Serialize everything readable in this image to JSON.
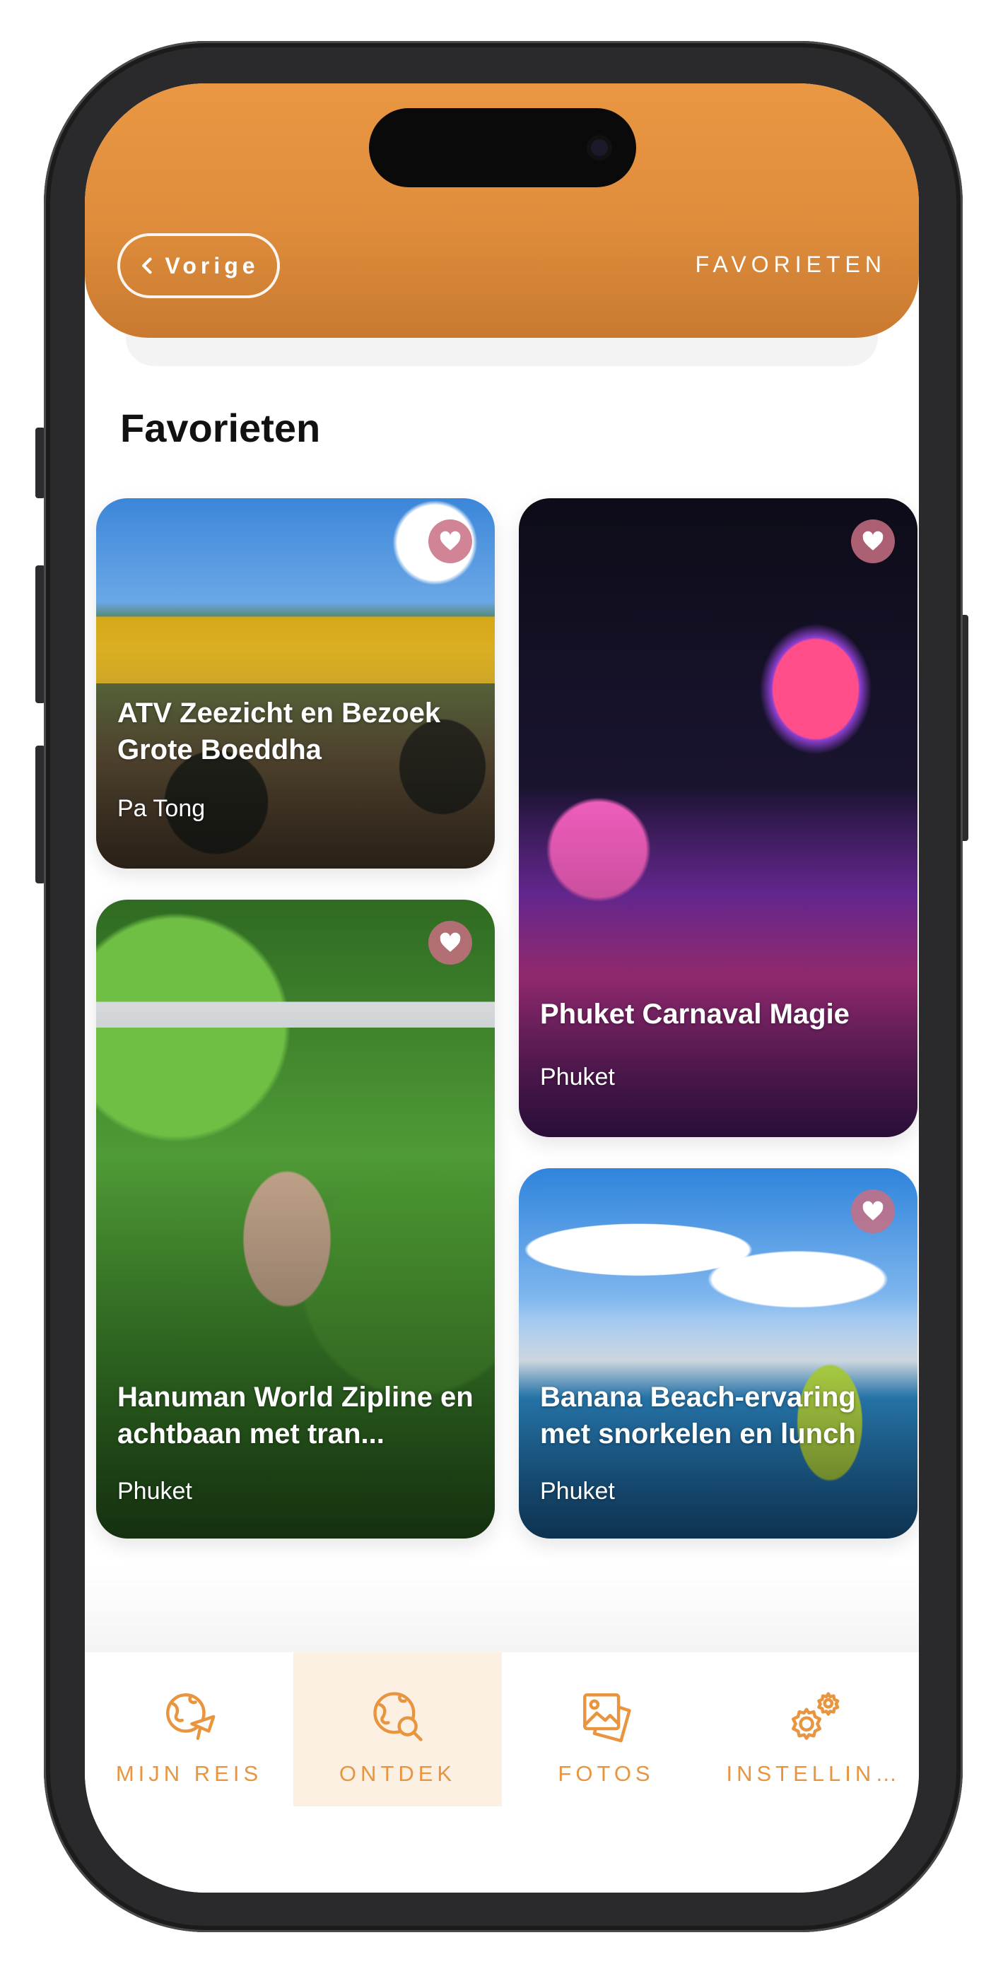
{
  "header": {
    "back_label": "Vorige",
    "title": "FAVORIETEN"
  },
  "section": {
    "title": "Favorieten"
  },
  "cards": [
    {
      "title": "ATV Zeezicht en Bezoek Grote Boeddha",
      "location": "Pa Tong",
      "image": "atv-quad-bike",
      "favorited": true
    },
    {
      "title": "Phuket Carnaval Magie",
      "location": "Phuket",
      "image": "carnival-night-lights",
      "favorited": true
    },
    {
      "title": "Hanuman World Zipline en achtbaan met tran...",
      "location": "Phuket",
      "image": "jungle-zipline",
      "favorited": true
    },
    {
      "title": "Banana Beach-ervaring met snorkelen en lunch",
      "location": "Phuket",
      "image": "beach-snorkel",
      "favorited": true
    }
  ],
  "nav": {
    "items": [
      {
        "label": "MIJN REIS",
        "icon": "globe-plane-icon",
        "active": false
      },
      {
        "label": "ONTDEK",
        "icon": "globe-search-icon",
        "active": true
      },
      {
        "label": "FOTOS",
        "icon": "photos-icon",
        "active": false
      },
      {
        "label": "INSTELLIN...",
        "icon": "gears-icon",
        "active": false
      }
    ]
  },
  "colors": {
    "accent": "#E9953F",
    "header": "#DF8D3C",
    "heart": "#C86E82"
  }
}
